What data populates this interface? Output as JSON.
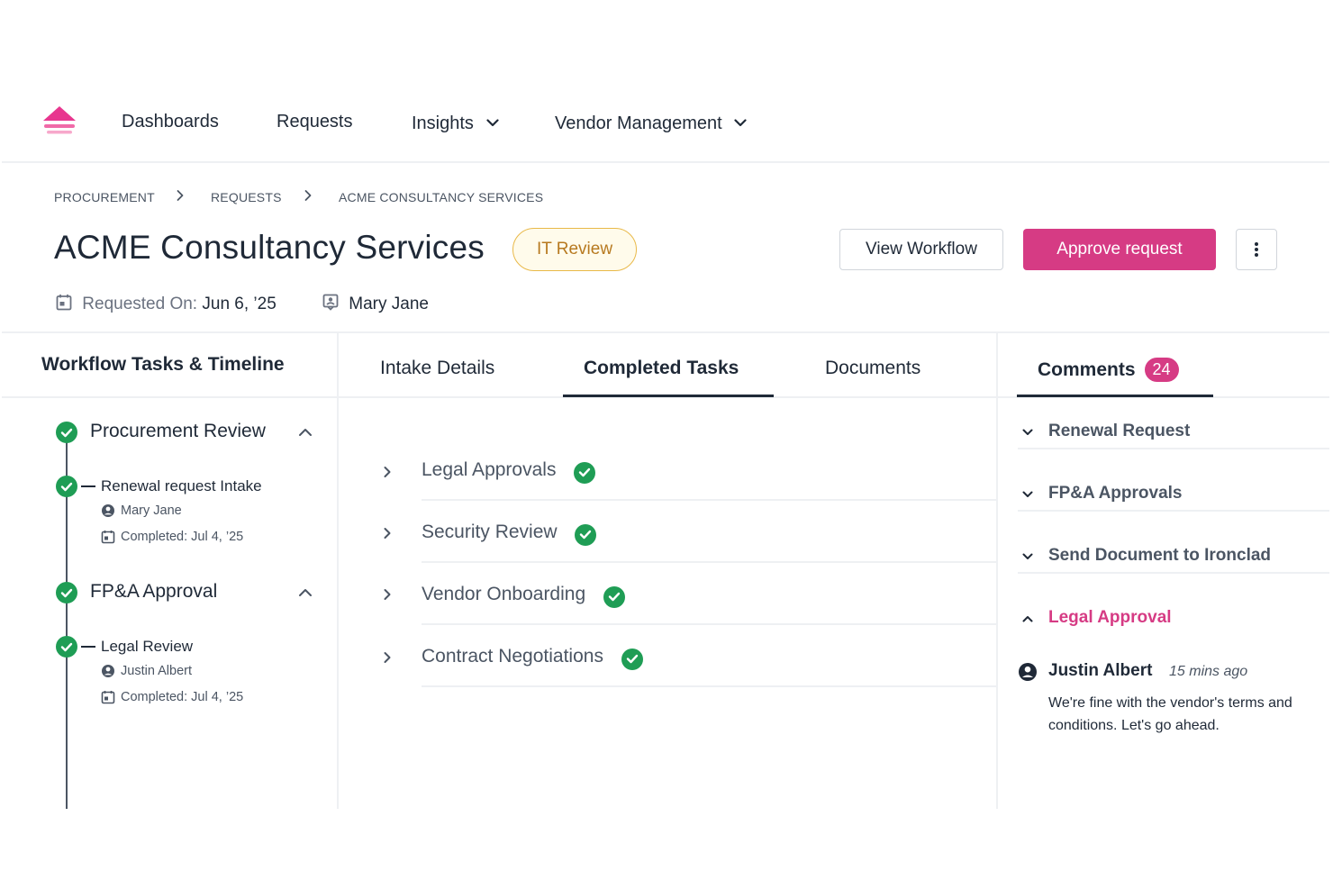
{
  "nav": {
    "items": [
      {
        "label": "Dashboards",
        "has_dropdown": false
      },
      {
        "label": "Requests",
        "has_dropdown": false
      },
      {
        "label": "Insights",
        "has_dropdown": true
      },
      {
        "label": "Vendor Management",
        "has_dropdown": true
      }
    ]
  },
  "breadcrumb": [
    "PROCUREMENT",
    "REQUESTS",
    "ACME CONSULTANCY SERVICES"
  ],
  "header": {
    "title": "ACME Consultancy Services",
    "status": "IT Review",
    "view_workflow_label": "View Workflow",
    "approve_label": "Approve request",
    "requested_on_label": "Requested On:",
    "requested_on_date": "Jun 6, ’25",
    "requester": "Mary Jane"
  },
  "workflow_panel": {
    "title": "Workflow Tasks & Timeline",
    "stages": [
      {
        "name": "Procurement Review",
        "task": "Renewal request Intake",
        "assignee": "Mary Jane",
        "completed": "Completed: Jul 4, ’25"
      },
      {
        "name": "FP&A Approval",
        "task": "Legal Review",
        "assignee": "Justin Albert",
        "completed": "Completed: Jul 4, ’25"
      }
    ]
  },
  "tabs": {
    "items": [
      "Intake Details",
      "Completed Tasks",
      "Documents"
    ],
    "active": "Completed Tasks"
  },
  "completed_tasks": [
    "Legal Approvals",
    "Security Review",
    "Vendor Onboarding",
    "Contract Negotiations"
  ],
  "comments": {
    "title": "Comments",
    "count": "24",
    "sections": [
      "Renewal Request",
      "FP&A Approvals",
      "Send Document to Ironclad",
      "Legal Approval"
    ],
    "open_section": "Legal Approval",
    "comment": {
      "author": "Justin Albert",
      "time": "15 mins ago",
      "text": "We're fine with the vendor's terms and conditions. Let's go ahead."
    }
  },
  "colors": {
    "brand": "#d63b84",
    "success": "#1f9d55",
    "status_badge_border": "#e9b949",
    "status_badge_text": "#b7791f"
  }
}
